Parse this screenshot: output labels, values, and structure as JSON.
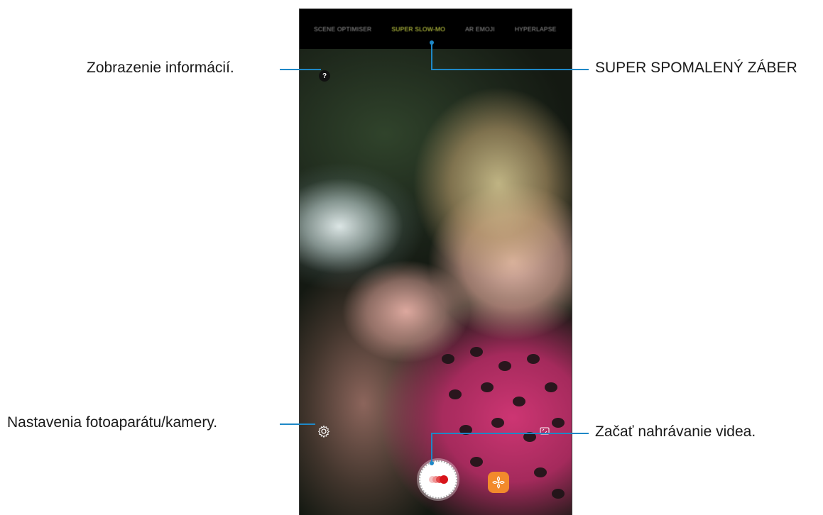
{
  "camera": {
    "modes": [
      "SCENE OPTIMISER",
      "SUPER SLOW-MO",
      "AR EMOJI",
      "HYPERLAPSE"
    ],
    "active_mode_index": 1,
    "info_icon_glyph": "?",
    "icons": {
      "info": "help-question-icon",
      "settings": "gear-icon",
      "flip": "flip-camera-icon",
      "record": "record-super-slow-mo-icon",
      "effects": "effects-flower-icon"
    },
    "colors": {
      "active_mode": "#d7e24a",
      "callout_line": "#1e88c7",
      "record_dots": [
        "#f5c3c3",
        "#ef8f8f",
        "#e2474a",
        "#d8141a"
      ],
      "effects_button": "#f28a2c"
    }
  },
  "callouts": {
    "info": "Zobrazenie informácií.",
    "super_slow_mo": "SUPER SPOMALENÝ ZÁBER",
    "settings": "Nastavenia fotoaparátu/kamery.",
    "start_recording": "Začať nahrávanie videa."
  }
}
